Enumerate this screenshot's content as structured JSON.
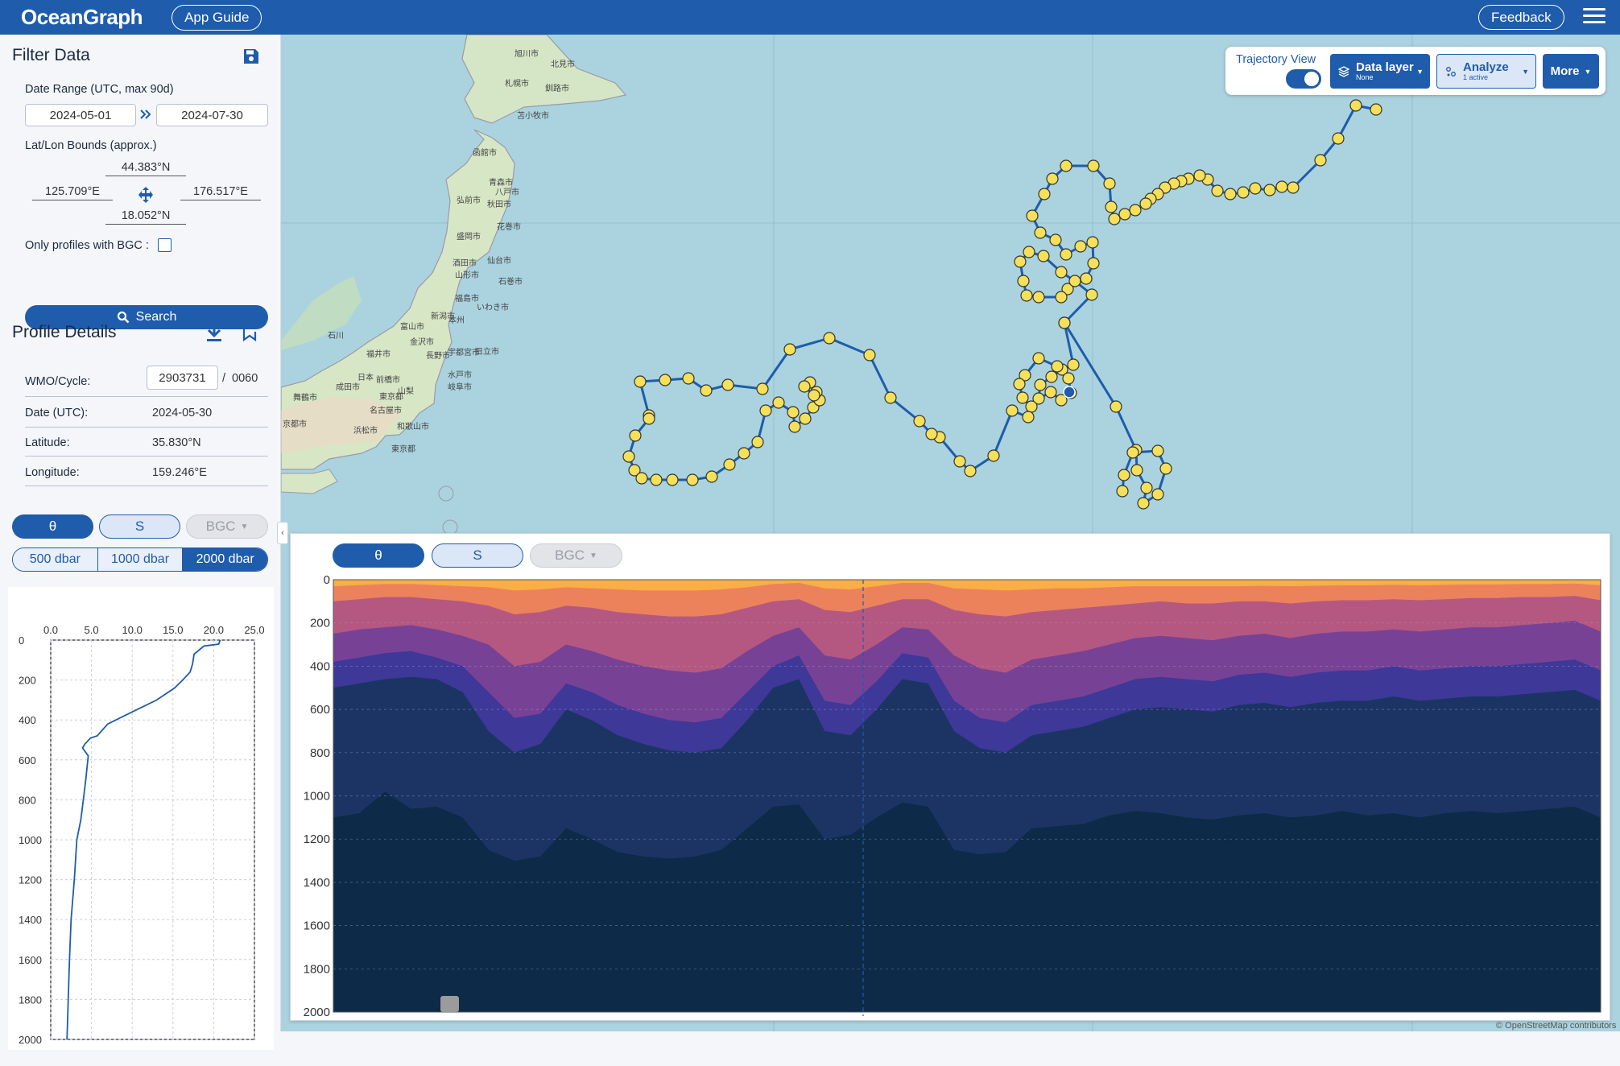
{
  "header": {
    "logo": "OceanGraph",
    "app_guide": "App Guide",
    "feedback": "Feedback",
    "menu_icon": "hamburger-menu-icon"
  },
  "filter": {
    "title": "Filter Data",
    "save_icon": "save-icon",
    "date_range_label": "Date Range (UTC, max 90d)",
    "date_start": "2024-05-01",
    "date_end": "2024-07-30",
    "bounds_label": "Lat/Lon Bounds (approx.)",
    "north": "44.383°N",
    "west": "125.709°E",
    "east": "176.517°E",
    "south": "18.052°N",
    "bgc_label": "Only profiles with BGC :",
    "bgc_checked": false,
    "search": "Search"
  },
  "profile": {
    "title": "Profile Details",
    "wmo_label": "WMO/Cycle:",
    "wmo": "2903731",
    "cycle_sep": "/",
    "cycle": "0060",
    "date_label": "Date (UTC):",
    "date": "2024-05-30",
    "lat_label": "Latitude:",
    "lat": "35.830°N",
    "lon_label": "Longitude:",
    "lon": "159.246°E"
  },
  "profile_tabs": {
    "theta": "θ",
    "salinity": "S",
    "bgc": "BGC",
    "depth_options": [
      "500 dbar",
      "1000 dbar",
      "2000 dbar"
    ],
    "selected_depth": "2000 dbar"
  },
  "map": {
    "trajectory_view": "Trajectory View",
    "trajectory_on": true,
    "data_layer": "Data layer",
    "data_layer_sub": "None",
    "analyze": "Analyze",
    "analyze_sub": "1 active",
    "more": "More",
    "attribution": "© OpenStreetMap contributors",
    "place_labels": [
      "旭川市",
      "北見市",
      "札幌市",
      "釧路市",
      "苫小牧市",
      "函館市",
      "青森市",
      "八戸市",
      "弘前市",
      "秋田市",
      "盛岡市",
      "花巻市",
      "酒田市",
      "山形市",
      "仙台市",
      "石巻市",
      "福島市",
      "本州",
      "いわき市",
      "新潟市",
      "富山市",
      "石川",
      "金沢市",
      "長野市",
      "宇都宮市",
      "日立市",
      "福井市",
      "日本",
      "前橋市",
      "水戸市",
      "岐阜市",
      "山梨",
      "成田市",
      "東京都",
      "舞鶴市",
      "名古屋市",
      "京都市",
      "和歌山市",
      "浜松市",
      "東京都"
    ]
  },
  "section": {
    "theta": "θ",
    "salinity": "S",
    "bgc": "BGC"
  },
  "colors": {
    "brand": "#1f5cab",
    "ocean": "#aad3df",
    "float_point": "#f5e05a",
    "selected_point": "#1f5cab"
  },
  "chart_data": [
    {
      "type": "line",
      "title": "",
      "xlabel": "",
      "ylabel": "",
      "xlim": [
        0,
        25
      ],
      "ylim": [
        2000,
        0
      ],
      "x_ticks": [
        "0.0",
        "5.0",
        "10.0",
        "15.0",
        "20.0",
        "25.0"
      ],
      "y_ticks": [
        "0",
        "200",
        "400",
        "600",
        "800",
        "1000",
        "1200",
        "1400",
        "1600",
        "1800",
        "2000"
      ],
      "grid": true,
      "series": [
        {
          "x": [
            20.8,
            20.6,
            18.8,
            17.6,
            17.4,
            17.1,
            16.2,
            15.2,
            13.0,
            11.0,
            9.0,
            7.0,
            5.7,
            4.9,
            4.2,
            3.9,
            4.6,
            4.3,
            4.0,
            3.7,
            3.2,
            2.9,
            2.5,
            2.3,
            2.0
          ],
          "y": [
            0,
            20,
            30,
            70,
            120,
            160,
            200,
            240,
            300,
            340,
            380,
            420,
            480,
            490,
            520,
            540,
            580,
            700,
            800,
            900,
            1000,
            1200,
            1400,
            1600,
            2000
          ]
        }
      ]
    },
    {
      "type": "heatmap",
      "title": "",
      "xlabel": "",
      "ylabel": "",
      "ylim": [
        2000,
        0
      ],
      "y_ticks": [
        "0",
        "200",
        "400",
        "600",
        "800",
        "1000",
        "1200",
        "1400",
        "1600",
        "1800",
        "2000"
      ],
      "grid": true,
      "colormap": [
        "#0d2a48",
        "#1d3566",
        "#2a3a84",
        "#40399b",
        "#5c3b9a",
        "#7a4296",
        "#9a4e8e",
        "#b85a7f",
        "#d8696c",
        "#ef8558",
        "#fbb044"
      ],
      "contour_depths_dbar": [
        {
          "levels": [
            1100,
            1080,
            980,
            1060,
            1050,
            1100,
            1250,
            1300,
            1280,
            1150,
            1200,
            1260,
            1280,
            1290,
            1280,
            1250,
            1150,
            1050,
            1040,
            1200,
            1180,
            1100,
            1030,
            1050,
            1250,
            1270,
            1260,
            1150,
            1140,
            1130,
            1090,
            1070,
            1080,
            1100,
            1110,
            1090,
            1080,
            1100,
            1090,
            1070,
            1090,
            1080,
            1100,
            1080,
            1070,
            1080,
            1070,
            1060,
            1050,
            1100
          ]
        },
        {
          "levels": [
            500,
            480,
            460,
            450,
            460,
            520,
            700,
            800,
            760,
            600,
            650,
            720,
            760,
            790,
            800,
            780,
            650,
            500,
            460,
            700,
            720,
            600,
            460,
            480,
            700,
            780,
            800,
            720,
            700,
            680,
            640,
            600,
            590,
            600,
            610,
            580,
            570,
            590,
            570,
            560,
            560,
            540,
            560,
            550,
            540,
            540,
            530,
            520,
            510,
            560
          ]
        },
        {
          "levels": [
            380,
            360,
            340,
            330,
            360,
            400,
            520,
            640,
            620,
            480,
            520,
            580,
            620,
            650,
            660,
            640,
            520,
            400,
            350,
            560,
            580,
            470,
            340,
            360,
            560,
            640,
            660,
            580,
            560,
            540,
            500,
            460,
            450,
            460,
            470,
            440,
            430,
            450,
            430,
            420,
            420,
            400,
            420,
            410,
            400,
            400,
            390,
            380,
            370,
            420
          ]
        },
        {
          "levels": [
            250,
            230,
            220,
            210,
            230,
            260,
            300,
            400,
            380,
            300,
            330,
            370,
            400,
            420,
            430,
            410,
            330,
            260,
            220,
            350,
            370,
            300,
            220,
            230,
            350,
            410,
            430,
            370,
            350,
            330,
            300,
            270,
            260,
            270,
            280,
            260,
            250,
            270,
            250,
            240,
            240,
            230,
            240,
            230,
            220,
            220,
            210,
            200,
            190,
            240
          ]
        },
        {
          "levels": [
            100,
            90,
            80,
            80,
            90,
            100,
            120,
            160,
            150,
            120,
            130,
            150,
            160,
            170,
            170,
            160,
            130,
            100,
            90,
            140,
            150,
            120,
            90,
            90,
            140,
            160,
            170,
            150,
            140,
            130,
            120,
            110,
            100,
            110,
            110,
            100,
            100,
            110,
            100,
            95,
            95,
            90,
            95,
            90,
            85,
            85,
            80,
            80,
            75,
            95
          ]
        },
        {
          "levels": [
            30,
            25,
            20,
            20,
            25,
            30,
            35,
            50,
            45,
            35,
            40,
            45,
            50,
            50,
            50,
            45,
            35,
            20,
            15,
            40,
            45,
            30,
            15,
            15,
            40,
            45,
            50,
            45,
            40,
            40,
            35,
            30,
            30,
            30,
            30,
            30,
            28,
            30,
            28,
            26,
            26,
            24,
            26,
            24,
            22,
            22,
            20,
            20,
            18,
            26
          ]
        }
      ]
    }
  ]
}
